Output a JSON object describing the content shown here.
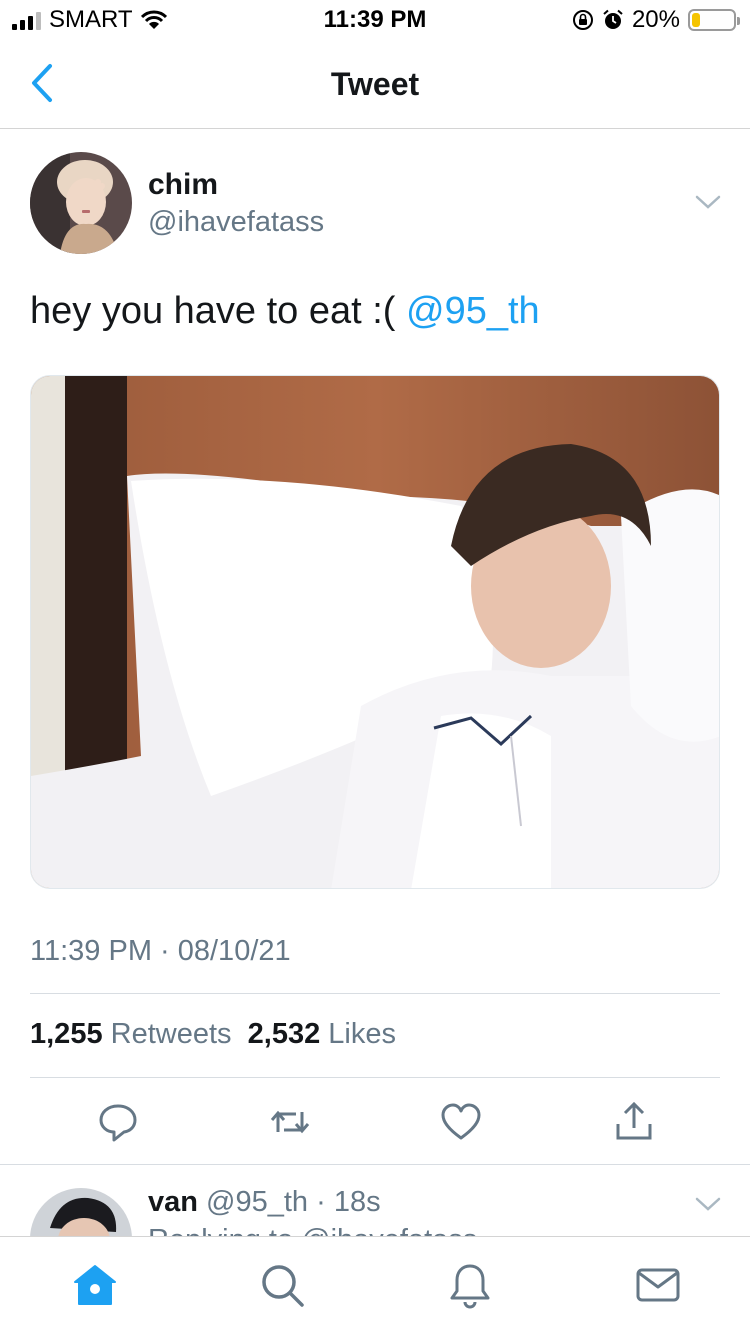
{
  "status_bar": {
    "carrier": "SMART",
    "time": "11:39 PM",
    "battery_pct": "20%",
    "battery_level": 0.2,
    "icons": [
      "signal-icon",
      "wifi-icon",
      "rotation-lock-icon",
      "alarm-icon",
      "battery-icon"
    ]
  },
  "nav": {
    "title": "Tweet",
    "back_icon": "chevron-left-icon"
  },
  "tweet": {
    "name": "chim",
    "handle": "@ihavefatass",
    "text": "hey you have to eat :( ",
    "mention": "@95_th",
    "timestamp": "11:39 PM · 08/10/21",
    "retweets_count": "1,255",
    "retweets_label": "Retweets",
    "likes_count": "2,532",
    "likes_label": "Likes"
  },
  "actions": [
    "reply-icon",
    "retweet-icon",
    "like-icon",
    "share-icon"
  ],
  "reply": {
    "name": "van",
    "handle": "@95_th",
    "time": "· 18s",
    "sub": "Replying to @ihavefatass"
  },
  "tabbar": [
    "home-icon",
    "search-icon",
    "notifications-icon",
    "messages-icon"
  ],
  "colors": {
    "accent": "#1da1f2",
    "secondary_text": "#657786",
    "primary_text": "#14171a",
    "battery": "#f5c400"
  }
}
